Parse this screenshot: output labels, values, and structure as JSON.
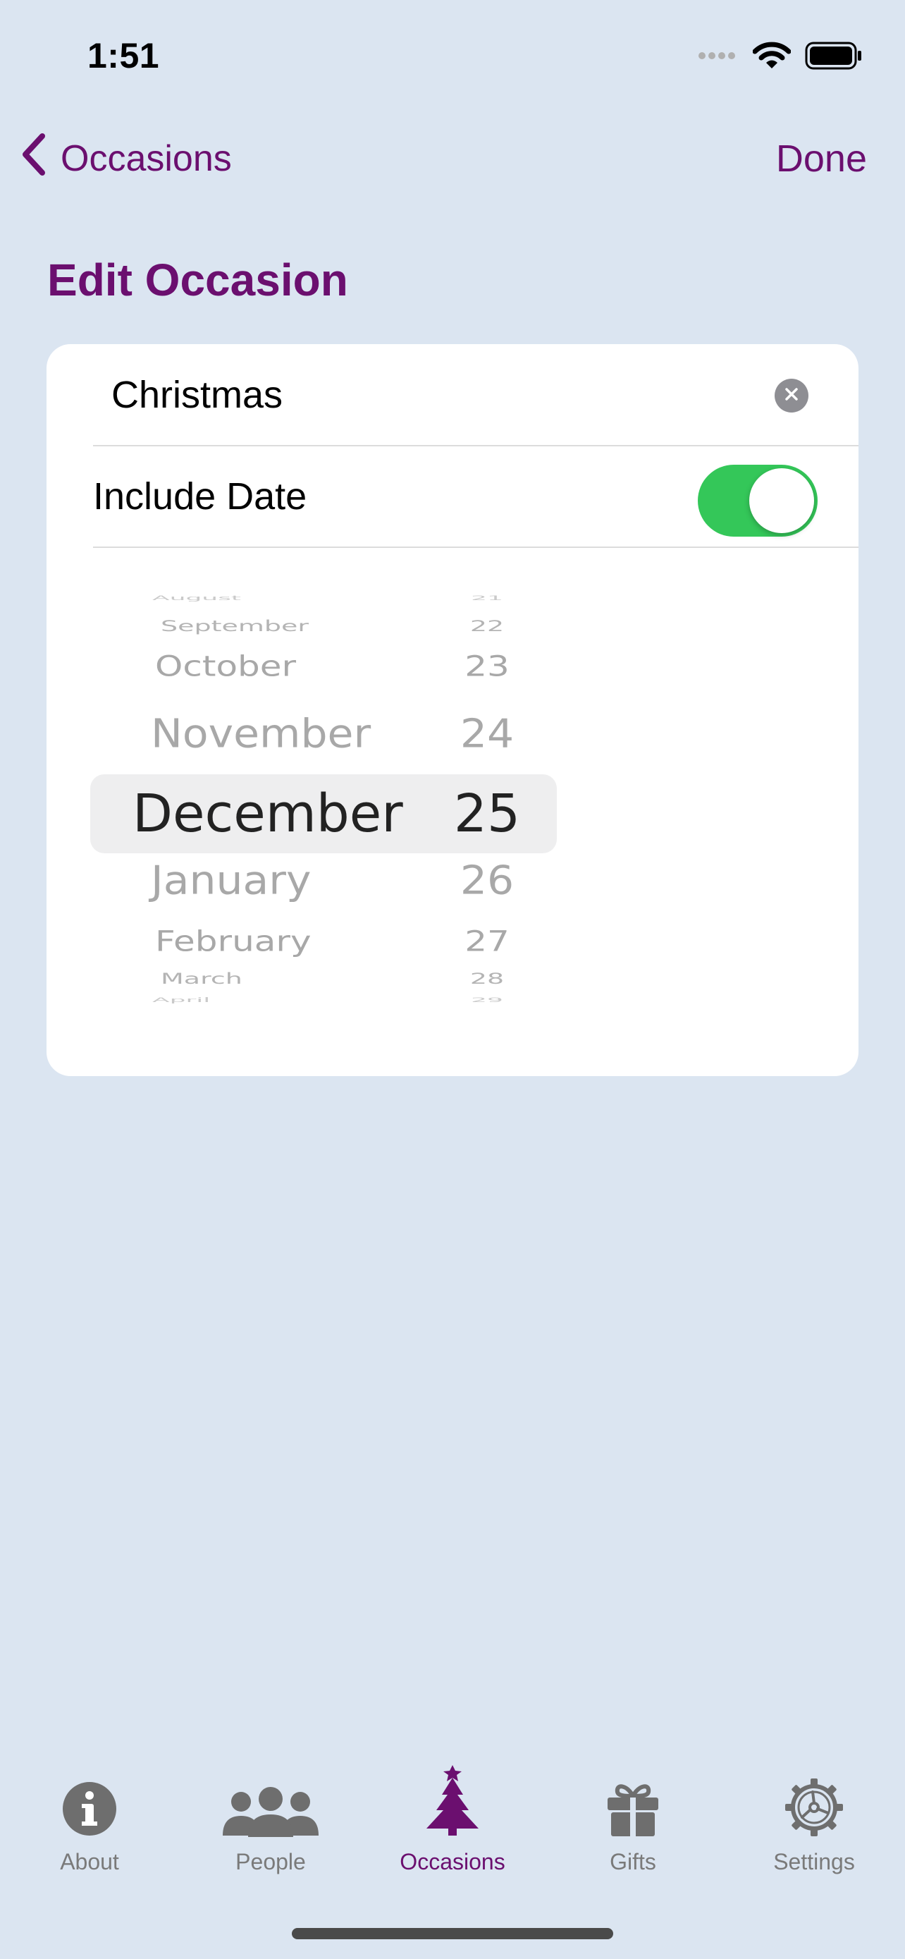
{
  "status": {
    "time": "1:51"
  },
  "nav": {
    "back_label": "Occasions",
    "done_label": "Done"
  },
  "page": {
    "title": "Edit Occasion"
  },
  "form": {
    "name_value": "Christmas",
    "include_date_label": "Include Date",
    "include_date_on": true
  },
  "picker": {
    "months": [
      "August",
      "September",
      "October",
      "November",
      "December",
      "January",
      "February",
      "March",
      "April"
    ],
    "days": [
      "21",
      "22",
      "23",
      "24",
      "25",
      "26",
      "27",
      "28",
      "29"
    ],
    "selected_month": "December",
    "selected_day": "25"
  },
  "tabs": [
    {
      "label": "About",
      "icon": "info-icon",
      "active": false
    },
    {
      "label": "People",
      "icon": "people-icon",
      "active": false
    },
    {
      "label": "Occasions",
      "icon": "christmas-tree-icon",
      "active": true
    },
    {
      "label": "Gifts",
      "icon": "gift-icon",
      "active": false
    },
    {
      "label": "Settings",
      "icon": "gear-icon",
      "active": false
    }
  ],
  "colors": {
    "accent": "#6b0f6f",
    "toggle_on": "#34c759",
    "background": "#dbe5f1"
  }
}
